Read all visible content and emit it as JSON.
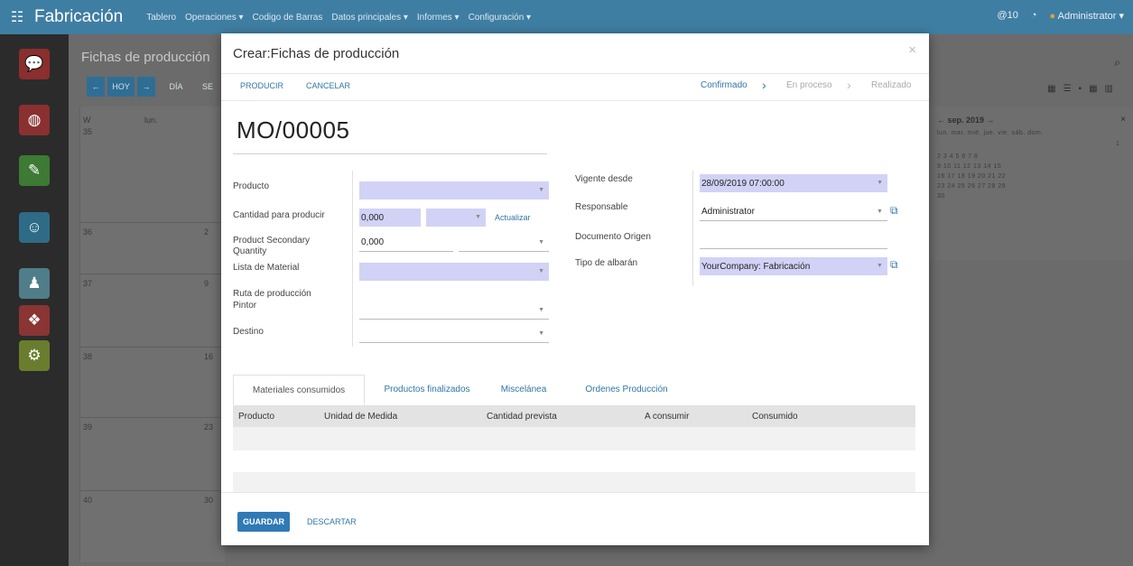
{
  "topbar": {
    "app_name": "Fabricación",
    "menus": [
      "Tablero",
      "Operaciones ▾",
      "Codigo de Barras",
      "Datos principales ▾",
      "Informes ▾",
      "Configuración ▾"
    ],
    "messages_count": "10",
    "user": "Administrator"
  },
  "background": {
    "title": "Fichas de producción",
    "buttons": {
      "today": "HOY",
      "day": "DÍA",
      "week": "SE"
    },
    "calendar": {
      "week_header": "W",
      "day_header": "lun.",
      "weeks": [
        "35",
        "36",
        "37",
        "38",
        "39",
        "40"
      ],
      "days": [
        "",
        "2",
        "9",
        "16",
        "23",
        "30"
      ]
    },
    "mini_calendar": {
      "title": "sep. 2019",
      "weekdays": "lun.  mar.  mié.  jue.  vie.  sáb.  dom.",
      "rows": [
        "1",
        "2  3  4  5  6  7  8",
        "9  10  11  12  13  14  15",
        "16  17  18  19  20  21  22",
        "23  24  25  26  27  28  29",
        "30"
      ]
    }
  },
  "modal": {
    "title": "Crear:Fichas de producción",
    "close": "×",
    "actions": {
      "produce": "PRODUCIR",
      "cancel": "CANCELAR"
    },
    "stages": {
      "confirmed": "Confirmado",
      "in_progress": "En proceso",
      "done": "Realizado"
    },
    "doc_name": "MO/00005",
    "left_fields": {
      "product_label": "Producto",
      "qty_label": "Cantidad para producir",
      "qty_value": "0,000",
      "update_link": "Actualizar",
      "secondary_label": "Product Secondary Quantity",
      "secondary_value": "0,000",
      "bom_label": "Lista de Material",
      "route_label": "Ruta de producción",
      "painter_label": "Pintor",
      "dest_label": "Destino"
    },
    "right_fields": {
      "valid_from_label": "Vigente desde",
      "valid_from_value": "28/09/2019 07:00:00",
      "responsible_label": "Responsable",
      "responsible_value": "Administrator",
      "origin_label": "Documento Origen",
      "picking_type_label": "Tipo de albarán",
      "picking_type_value": "YourCompany: Fabricación"
    },
    "tabs": [
      "Materiales consumidos",
      "Productos finalizados",
      "Miscelánea",
      "Ordenes Producción"
    ],
    "table_headers": [
      "Producto",
      "Unidad de Medida",
      "Cantidad prevista",
      "A consumir",
      "Consumido"
    ],
    "footer": {
      "save": "GUARDAR",
      "discard": "DESCARTAR"
    }
  }
}
